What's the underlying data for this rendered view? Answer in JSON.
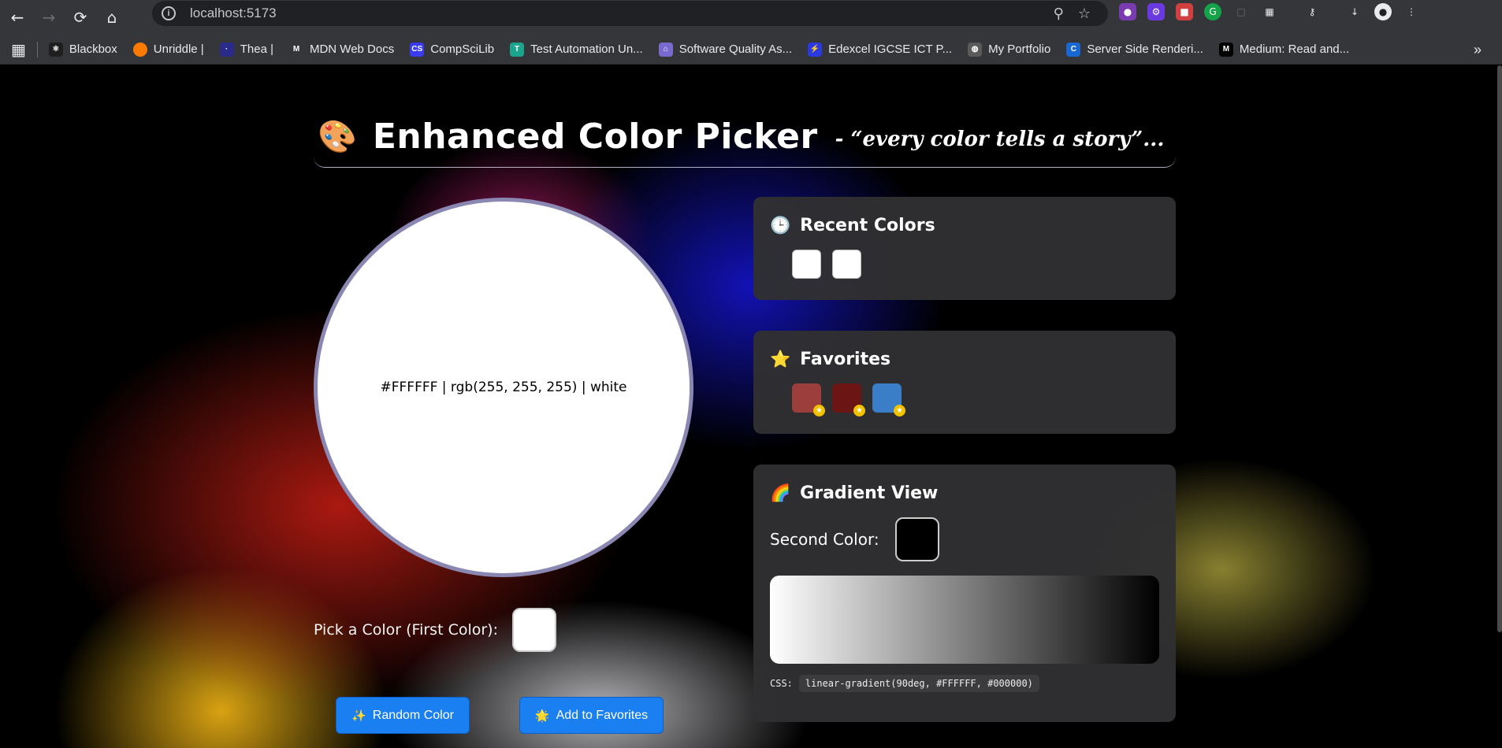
{
  "browser": {
    "url": "localhost:5173",
    "bookmarks": [
      {
        "label": "Blackbox",
        "color": "#1e1e1e",
        "glyph": "⚛"
      },
      {
        "label": "Unriddle |",
        "color": "#ff7a00",
        "glyph": ""
      },
      {
        "label": "Thea |",
        "color": "#2a2a8a",
        "glyph": "·"
      },
      {
        "label": "MDN Web Docs",
        "color": "#35363a",
        "glyph": "M"
      },
      {
        "label": "CompSciLib",
        "color": "#3a3af0",
        "glyph": "CS"
      },
      {
        "label": "Test Automation Un...",
        "color": "#1aa58c",
        "glyph": "T"
      },
      {
        "label": "Software Quality As...",
        "color": "#7a6ad0",
        "glyph": "⌂"
      },
      {
        "label": "Edexcel IGCSE ICT P...",
        "color": "#2a3ae0",
        "glyph": "⚡"
      },
      {
        "label": "My Portfolio",
        "color": "#5a5a5a",
        "glyph": "◍"
      },
      {
        "label": "Server Side Renderi...",
        "color": "#1967d2",
        "glyph": "C"
      },
      {
        "label": "Medium: Read and...",
        "color": "#000000",
        "glyph": "M"
      }
    ],
    "more_glyph": "»"
  },
  "header": {
    "icon": "palette-icon",
    "emoji": "🎨",
    "title": "Enhanced Color Picker",
    "tagline": "- “every color tells a story”..."
  },
  "preview": {
    "color": "#FFFFFF",
    "label": "#FFFFFF | rgb(255, 255, 255) | white"
  },
  "picker": {
    "label": "Pick a Color (First Color):",
    "value": "#FFFFFF"
  },
  "buttons": {
    "random": {
      "icon": "✨",
      "label": "Random Color"
    },
    "favorite": {
      "icon": "🌟",
      "label": "Add to Favorites"
    }
  },
  "recent": {
    "icon": "🕒",
    "title": "Recent Colors",
    "colors": [
      "#FFFFFF",
      "#FFFFFF"
    ]
  },
  "favorites": {
    "icon": "⭐",
    "title": "Favorites",
    "colors": [
      "#9c3f3c",
      "#6b1515",
      "#3a7ec8"
    ],
    "star_glyph": "★"
  },
  "gradient": {
    "icon": "🌈",
    "title": "Gradient View",
    "second_label": "Second Color:",
    "second_color": "#000000",
    "css_label": "CSS:",
    "css_value": "linear-gradient(90deg, #FFFFFF, #000000)"
  }
}
